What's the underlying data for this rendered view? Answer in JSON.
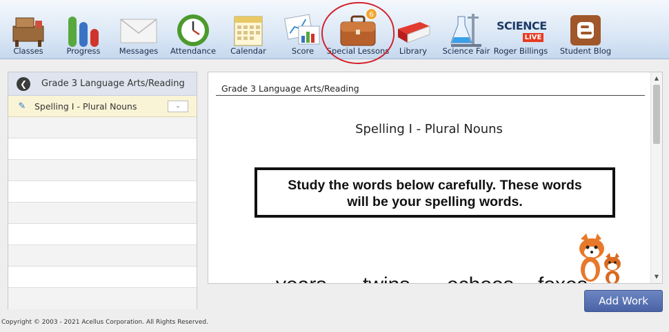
{
  "toolbar": {
    "items": [
      {
        "label": "Classes",
        "icon": "desk-icon"
      },
      {
        "label": "Progress",
        "icon": "progress-bars-icon"
      },
      {
        "label": "Messages",
        "icon": "envelope-icon"
      },
      {
        "label": "Attendance",
        "icon": "clock-icon"
      },
      {
        "label": "Calendar",
        "icon": "calendar-icon"
      },
      {
        "label": "Score",
        "icon": "score-chart-icon"
      },
      {
        "label": "Special Lessons",
        "icon": "briefcase-icon",
        "badge": "6"
      },
      {
        "label": "Library",
        "icon": "book-icon"
      },
      {
        "label": "Science Fair",
        "icon": "lab-flask-icon"
      },
      {
        "label": "Roger Billings",
        "icon": "science-live-icon",
        "logo_text": "SCIENCE",
        "logo_sub": "LIVE"
      },
      {
        "label": "Student Blog",
        "icon": "blog-icon"
      }
    ]
  },
  "sidebar": {
    "header": "Grade 3 Language Arts/Reading",
    "back_icon": "chevron-left-icon",
    "items": [
      {
        "label": "Spelling I - Plural Nouns",
        "action": "-"
      }
    ]
  },
  "content": {
    "course_title": "Grade 3 Language Arts/Reading",
    "lesson_title": "Spelling I - Plural Nouns",
    "instruction_line1": "Study the words below carefully.  These words",
    "instruction_line2": "will be your spelling words.",
    "partial_words": [
      "years",
      "twins",
      "echoes",
      "foxes"
    ]
  },
  "buttons": {
    "add_work": "Add Work"
  },
  "footer": {
    "copyright": "Copyright © 2003 - 2021 Acellus Corporation.  All Rights Reserved."
  },
  "colors": {
    "accent_blue": "#4a63a6",
    "highlight_row": "#faf4d6",
    "annotation_red": "#d3202b",
    "badge_orange": "#f2a733"
  }
}
